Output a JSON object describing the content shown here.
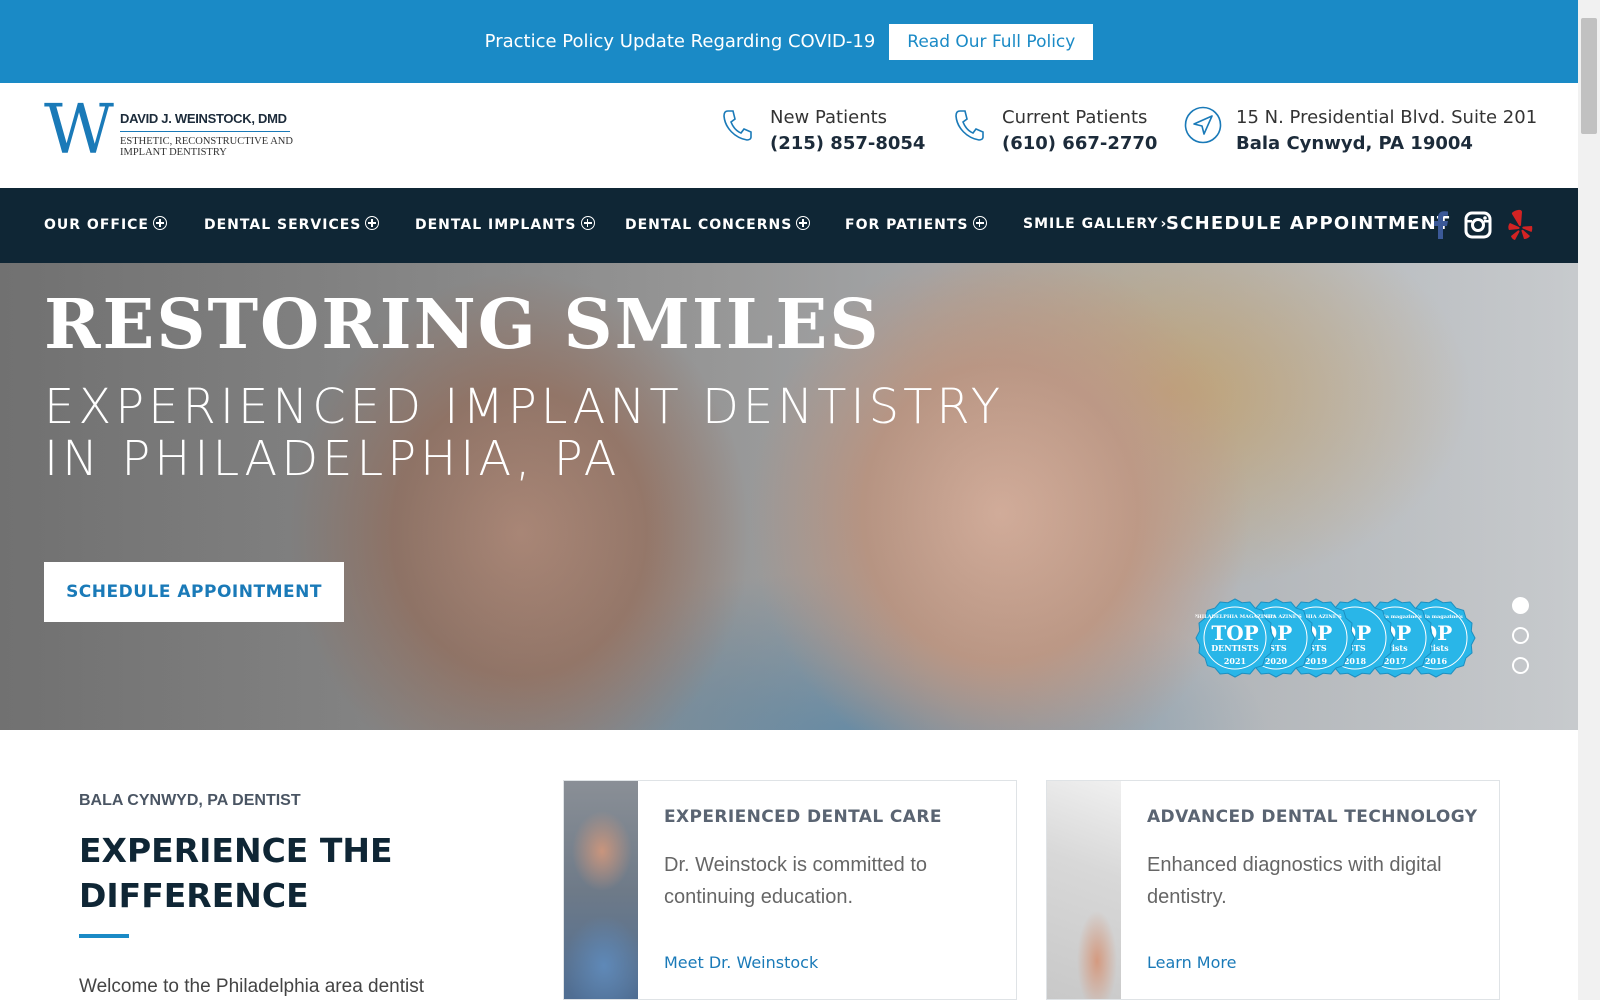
{
  "covid": {
    "text": "Practice Policy Update Regarding COVID-19",
    "button": "Read Our Full Policy"
  },
  "logo": {
    "letter": "W",
    "name": "DAVID J. WEINSTOCK, DMD",
    "tagline": "ESTHETIC, RECONSTRUCTIVE AND IMPLANT DENTISTRY"
  },
  "contacts": [
    {
      "label": "New Patients",
      "value": "(215) 857-8054",
      "icon": "phone-icon"
    },
    {
      "label": "Current Patients",
      "value": "(610) 667-2770",
      "icon": "phone-icon"
    },
    {
      "label": "15 N. Presidential Blvd. Suite 201",
      "value": "Bala Cynwyd, PA 19004",
      "icon": "location-arrow-icon"
    }
  ],
  "nav": {
    "items": [
      "OUR OFFICE",
      "DENTAL SERVICES",
      "DENTAL IMPLANTS",
      "DENTAL CONCERNS",
      "FOR PATIENTS",
      "SMILE GALLERY"
    ],
    "schedule": "SCHEDULE APPOINTMENT",
    "social": [
      "facebook-icon",
      "instagram-icon",
      "yelp-icon"
    ]
  },
  "hero": {
    "title": "RESTORING SMILES",
    "subtitle_line1": "EXPERIENCED IMPLANT DENTISTRY",
    "subtitle_line2": "IN PHILADELPHIA, PA",
    "button": "SCHEDULE APPOINTMENT",
    "badges": [
      {
        "year": "2021",
        "word": "TOP",
        "sub": "DENTISTS",
        "top": "PHILADELPHIA MAGAZINE'S"
      },
      {
        "year": "2020",
        "word": "OP",
        "sub": "ISTS",
        "top": "DELPHIA AZINE'S"
      },
      {
        "year": "2019",
        "word": "OP",
        "sub": "ISTS",
        "top": "DELPHIA AZINE'S"
      },
      {
        "year": "2018",
        "word": "OP",
        "sub": "ISTS",
        "top": ""
      },
      {
        "year": "2017",
        "word": "OP",
        "sub": "ntists",
        "top": "delphia magazine's"
      },
      {
        "year": "2016",
        "word": "OP",
        "sub": "ntists",
        "top": "delphia magazine's"
      }
    ],
    "active_slide": 1,
    "slide_count": 3
  },
  "intro": {
    "kicker": "BALA CYNWYD, PA DENTIST",
    "title": "EXPERIENCE THE DIFFERENCE",
    "text": "Welcome to the Philadelphia area dentist"
  },
  "cards": [
    {
      "title": "EXPERIENCED DENTAL CARE",
      "text": "Dr. Weinstock is committed to continuing education.",
      "link": "Meet Dr. Weinstock"
    },
    {
      "title": "ADVANCED DENTAL TECHNOLOGY",
      "text": "Enhanced diagnostics with digital dentistry.",
      "link": "Learn More"
    }
  ],
  "colors": {
    "brand_blue": "#1a8ac6",
    "nav_dark": "#0f2635",
    "badge_blue": "#29b6e8"
  }
}
